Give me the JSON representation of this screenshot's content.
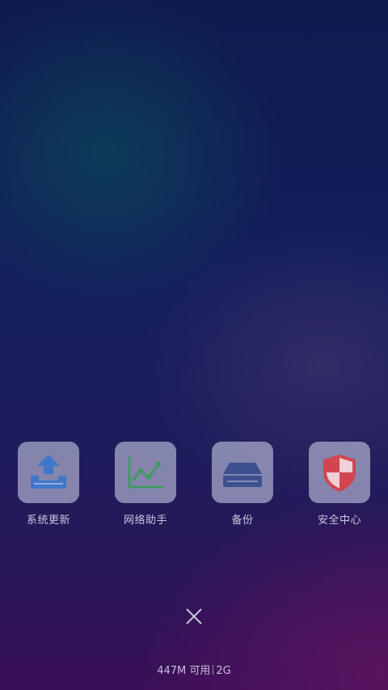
{
  "apps": [
    {
      "label": "系统更新",
      "icon": "upload-icon",
      "color": "#3f78c8"
    },
    {
      "label": "网络助手",
      "icon": "line-chart-icon",
      "color": "#3f9a62"
    },
    {
      "label": "备份",
      "icon": "storage-drive-icon",
      "color": "#3e4f8e"
    },
    {
      "label": "安全中心",
      "icon": "shield-icon",
      "color": "#d24651"
    }
  ],
  "close_icon": "close-icon",
  "memory": {
    "available_text": "447M 可用",
    "total_text": "2G"
  }
}
